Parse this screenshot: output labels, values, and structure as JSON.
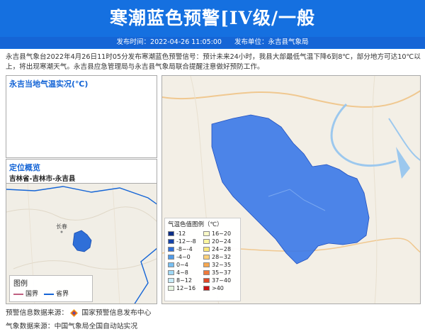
{
  "banner": {
    "title": "寒潮蓝色预警[IV级/一般",
    "publish_time_label": "发布时间：2022-04-26 11:05:00",
    "publisher_label": "发布单位：永吉县气象局"
  },
  "description": "永吉县气象台2022年4月26日11时05分发布寒潮蓝色预警信号：预计未来24小时，我县大部最低气温下降6到8℃，部分地方可达10℃以上，将出现寒潮天气。永吉县应急管理局与永吉县气象局联合提醒注意做好预防工作。",
  "temp_panel": {
    "title": "永吉当地气温实况(℃)"
  },
  "location_panel": {
    "title": "定位概览",
    "path": "吉林省-吉林市-永吉县"
  },
  "mini_map": {
    "legend_title": "图例",
    "national_border": "国界",
    "provincial_border": "省界",
    "city_label": "长春",
    "border_color_national": "#c06080",
    "border_color_provincial": "#1565d6",
    "highlight_color": "#2f6fd8"
  },
  "map": {
    "region_color": "#3a78e8",
    "legend": {
      "title": "气温色值图例（℃）",
      "left": [
        {
          "label": "-12",
          "color": "#0b2d86"
        },
        {
          "label": "-12~-8",
          "color": "#1442a8"
        },
        {
          "label": "-8~-4",
          "color": "#2f6fd8"
        },
        {
          "label": "-4~0",
          "color": "#4f9ae8"
        },
        {
          "label": "0~4",
          "color": "#77bff2"
        },
        {
          "label": "4~8",
          "color": "#9fd8f6"
        },
        {
          "label": "8~12",
          "color": "#c8ecf8"
        },
        {
          "label": "12~16",
          "color": "#e6f6e0"
        }
      ],
      "right": [
        {
          "label": "16~20",
          "color": "#fafac8"
        },
        {
          "label": "20~24",
          "color": "#fbf6a0"
        },
        {
          "label": "24~28",
          "color": "#fbe87a"
        },
        {
          "label": "28~32",
          "color": "#fbd07a"
        },
        {
          "label": "32~35",
          "color": "#f6a850"
        },
        {
          "label": "35~37",
          "color": "#f07a3c"
        },
        {
          "label": "37~40",
          "color": "#e04a28"
        },
        {
          "label": ">40",
          "color": "#c81414"
        }
      ]
    }
  },
  "footer": {
    "warning_source": "预警信息数据来源：",
    "warning_source_name": "国家预警信息发布中心",
    "weather_source": "气象数据来源：中国气象局全国自动站实况"
  }
}
